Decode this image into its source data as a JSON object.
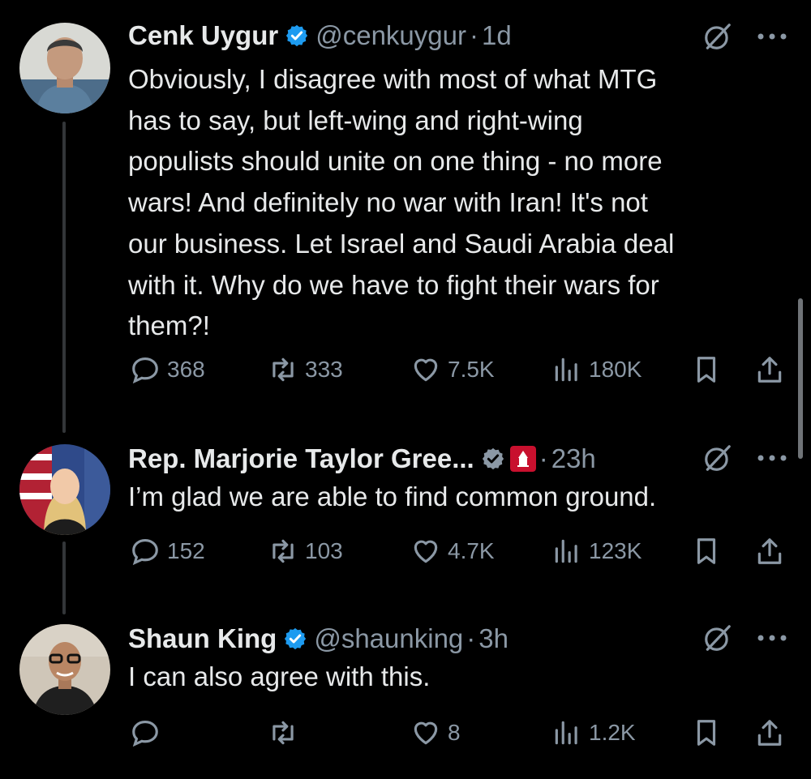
{
  "tweets": [
    {
      "name": "Cenk Uygur",
      "handle": "@cenkuygur",
      "sep": "·",
      "time": "1d",
      "text": "Obviously, I disagree with most of what MTG\nhas to say, but left-wing and right-wing\npopulists should unite on one thing - no more\nwars! And definitely no war with Iran! It's not\nour business. Let Israel and Saudi Arabia deal\nwith it. Why do we have to fight their wars for\nthem?!",
      "replies": "368",
      "reposts": "333",
      "likes": "7.5K",
      "views": "180K"
    },
    {
      "name": "Rep. Marjorie Taylor Gree...",
      "handle": "",
      "sep": "·",
      "time": "23h",
      "text": "I’m glad we are able to find common ground.",
      "replies": "152",
      "reposts": "103",
      "likes": "4.7K",
      "views": "123K"
    },
    {
      "name": "Shaun King",
      "handle": "@shaunking",
      "sep": "·",
      "time": "3h",
      "text": "I can also agree with this.",
      "replies": "",
      "reposts": "",
      "likes": "8",
      "views": "1.2K"
    }
  ],
  "icons": {
    "reply": "reply-icon",
    "repost": "repost-icon",
    "like": "like-icon",
    "views": "views-icon",
    "bookmark": "bookmark-icon",
    "share": "share-icon",
    "grok": "grok-icon",
    "more": "more-icon",
    "verified": "verified-badge-icon",
    "affiliate": "house-gop-badge"
  },
  "colors": {
    "background": "#000000",
    "text": "#e7e9ea",
    "muted": "#8b98a5",
    "verified": "#1d9bf0",
    "affiliate_badge": "#c8102e"
  }
}
